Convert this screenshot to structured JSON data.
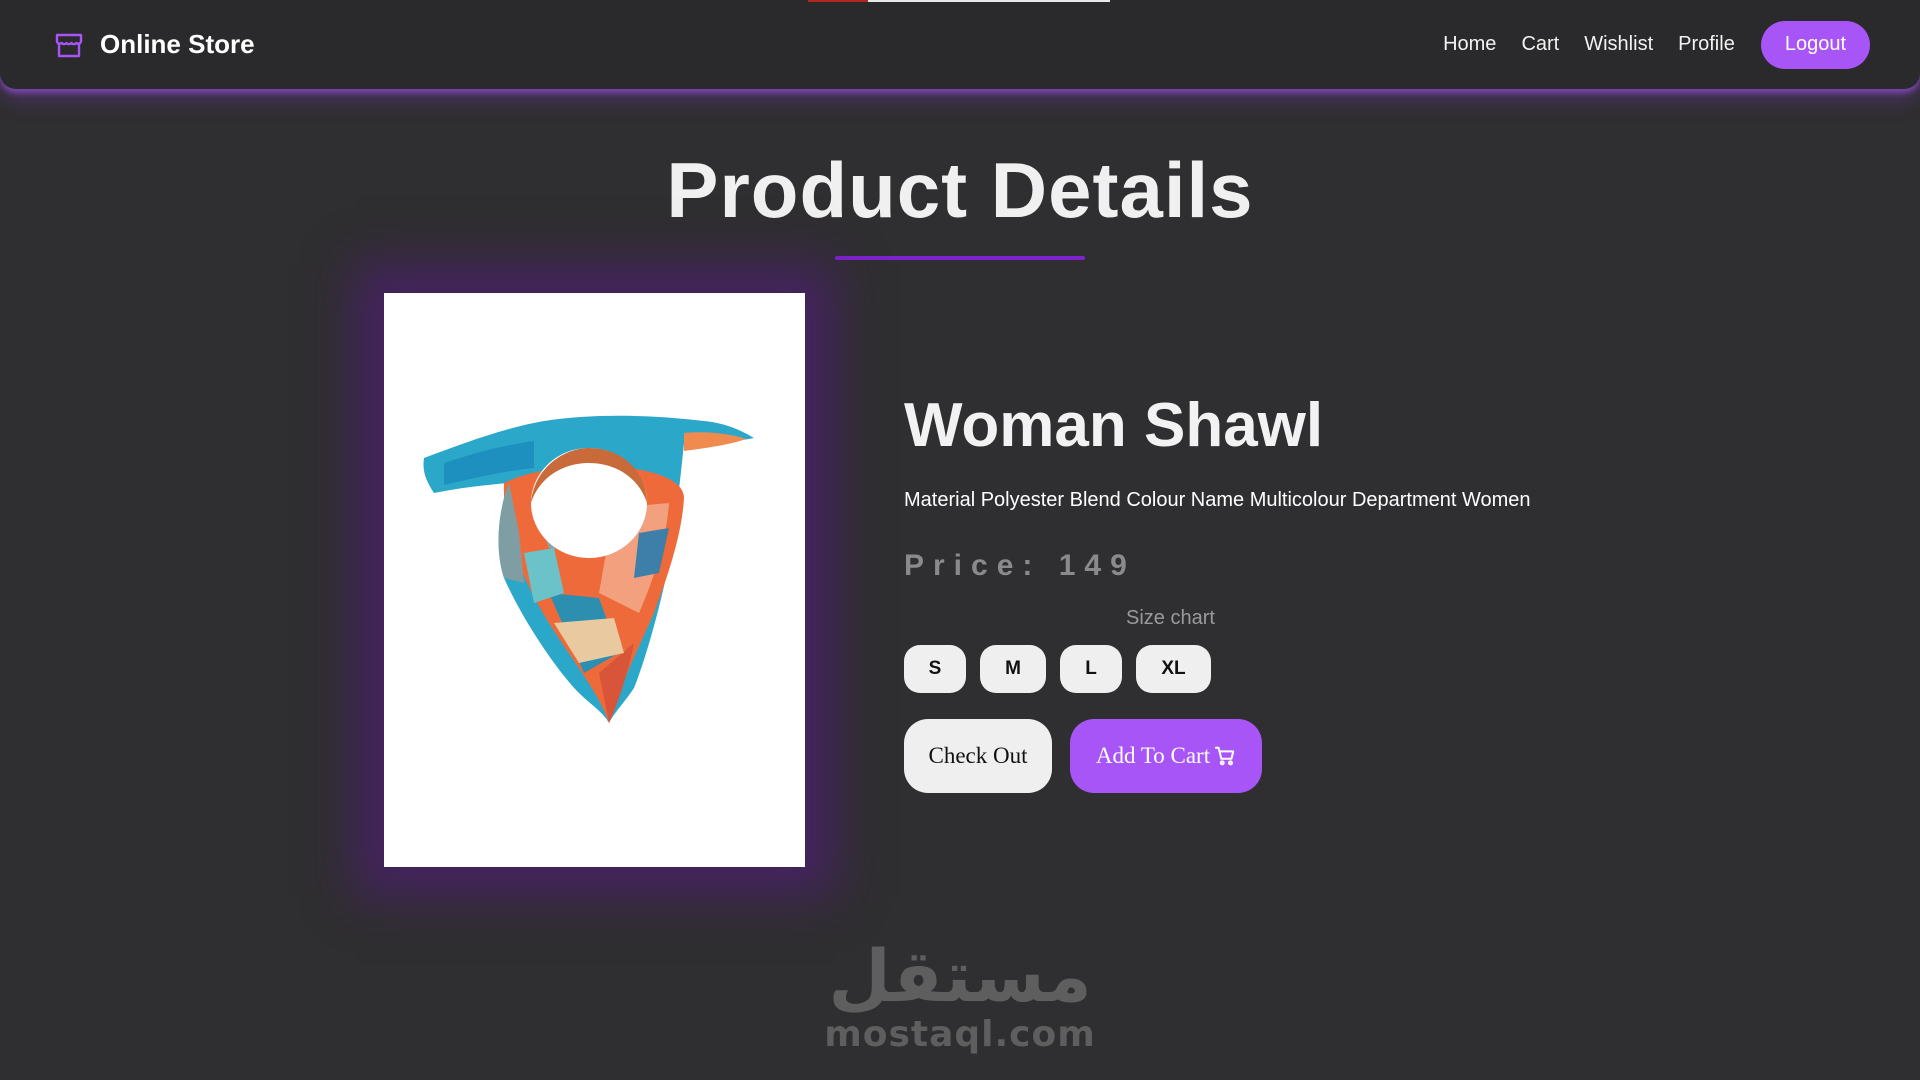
{
  "navbar": {
    "brand_name": "Online Store",
    "links": [
      "Home",
      "Cart",
      "Wishlist",
      "Profile"
    ],
    "logout_label": "Logout"
  },
  "page": {
    "title": "Product Details"
  },
  "product": {
    "name": "Woman Shawl",
    "description": "Material Polyester Blend Colour Name Multicolour Department Women",
    "price_label": "Price:",
    "price_value": "149",
    "size_chart_label": "Size chart",
    "sizes": [
      "S",
      "M",
      "L",
      "XL"
    ],
    "checkout_label": "Check Out",
    "add_to_cart_label": "Add To Cart"
  },
  "watermark": {
    "arabic": "مستقل",
    "latin": "mostaql.com"
  },
  "icons": {
    "brand": "store-icon",
    "add_to_cart": "cart-icon"
  },
  "colors": {
    "accent": "#a855f7",
    "accent_dark": "#7e22ce",
    "background": "#2f2e30",
    "navbar": "#2a292b"
  }
}
